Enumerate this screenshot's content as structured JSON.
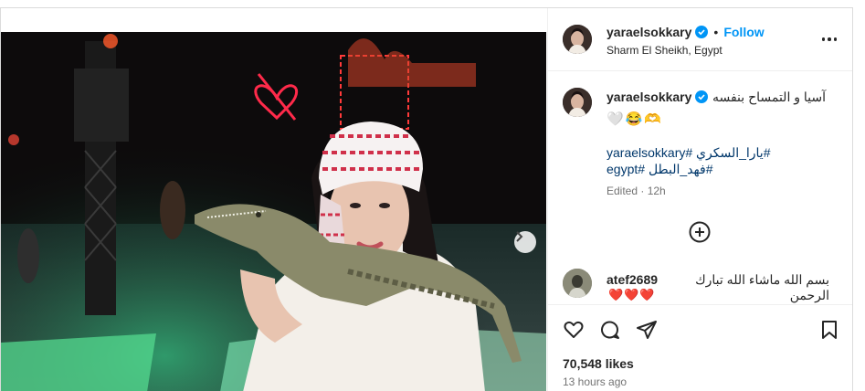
{
  "post": {
    "username": "yaraelsokkary",
    "follow_label": "Follow",
    "separator": "•",
    "location": "Sharm El Sheikh, Egypt",
    "caption_text": "آسيا و التمساح بنفسه",
    "caption_emoji": "🤍😂🫶",
    "hashtags_line1": "yaraelsokkary# يارا_السكري#",
    "hashtags_line2": "egypt# فهد_البطل#",
    "edited_label": "Edited · 12h",
    "likes": "70,548 likes",
    "time_ago": "13 hours ago"
  },
  "comment": {
    "username": "atef2689",
    "text": "بسم الله ماشاء الله تبارك الرحمن",
    "hearts": "❤️❤️❤️"
  },
  "colors": {
    "link_blue": "#0095f6",
    "hashtag_blue": "#00376b",
    "verified_blue": "#0095f6",
    "muted_text": "#737373",
    "heart_red": "#ed1c24"
  },
  "icons": [
    "verified-badge-icon",
    "more-options-icon",
    "chevron-right-icon",
    "add-comment-icon",
    "heart-icon",
    "comment-icon",
    "share-icon",
    "save-bookmark-icon"
  ],
  "carousel": {
    "slide_count": 2,
    "active_slide": 1
  }
}
